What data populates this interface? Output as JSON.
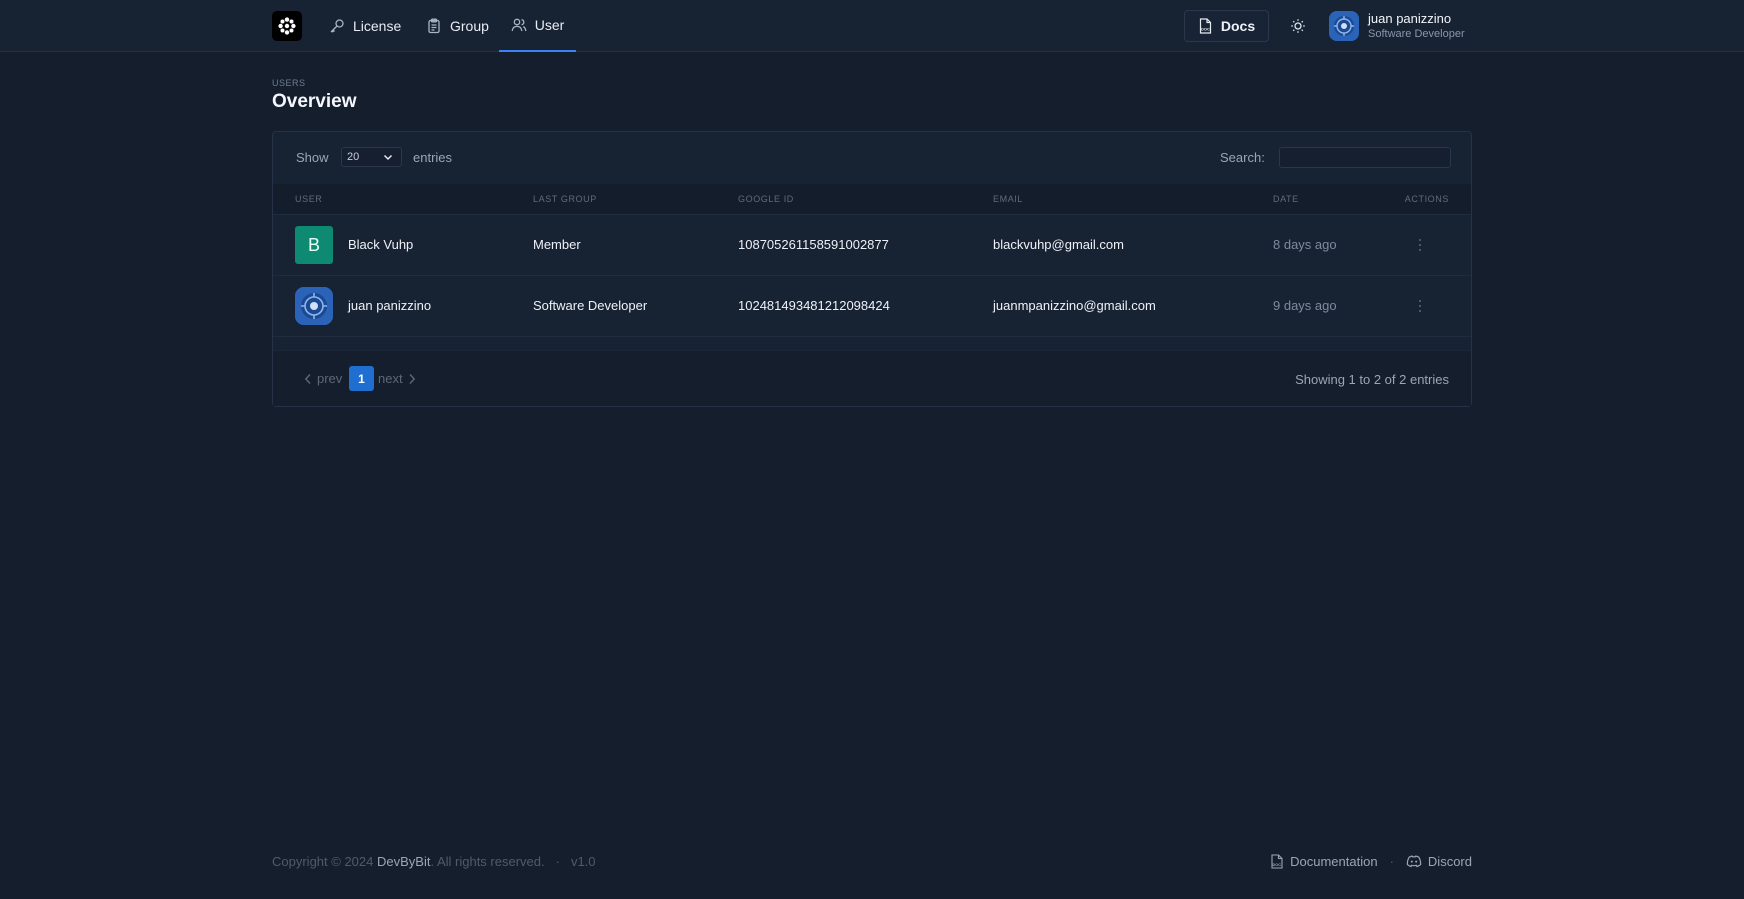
{
  "navbar": {
    "logo_icon": "flower-logo-icon",
    "links": [
      {
        "label": "License",
        "icon": "key-icon"
      },
      {
        "label": "Group",
        "icon": "clipboard-icon"
      },
      {
        "label": "User",
        "icon": "users-icon",
        "active": true
      }
    ],
    "docs_label": "Docs",
    "profile": {
      "name": "juan panizzino",
      "role": "Software Developer"
    }
  },
  "page": {
    "eyebrow": "USERS",
    "title": "Overview"
  },
  "table": {
    "show_label": "Show",
    "page_size": "20",
    "entries_label": "entries",
    "search_label": "Search:",
    "search_value": "",
    "columns": [
      "USER",
      "LAST GROUP",
      "GOOGLE ID",
      "EMAIL",
      "DATE",
      "ACTIONS"
    ],
    "rows": [
      {
        "avatar_letter": "B",
        "user": "Black Vuhp",
        "last_group": "Member",
        "google_id": "108705261158591002877",
        "email": "blackvuhp@gmail.com",
        "date": "8 days ago"
      },
      {
        "avatar_letter": "",
        "user": "juan panizzino",
        "last_group": "Software Developer",
        "google_id": "102481493481212098424",
        "email": "juanmpanizzino@gmail.com",
        "date": "9 days ago"
      }
    ],
    "pagination": {
      "prev": "prev",
      "current": "1",
      "next": "next"
    },
    "info": "Showing 1 to 2 of 2 entries"
  },
  "footer": {
    "copyright_prefix": "Copyright © 2024",
    "brand": "DevByBit",
    "copyright_suffix": ". All rights reserved.",
    "version": "v1.0",
    "links": [
      {
        "label": "Documentation",
        "icon": "doc-file-icon"
      },
      {
        "label": "Discord",
        "icon": "discord-icon"
      }
    ]
  },
  "colors": {
    "background": "#151e2c",
    "navbar": "#172233",
    "accent": "#1f6fd1",
    "avatar_green": "#0e8a73"
  }
}
